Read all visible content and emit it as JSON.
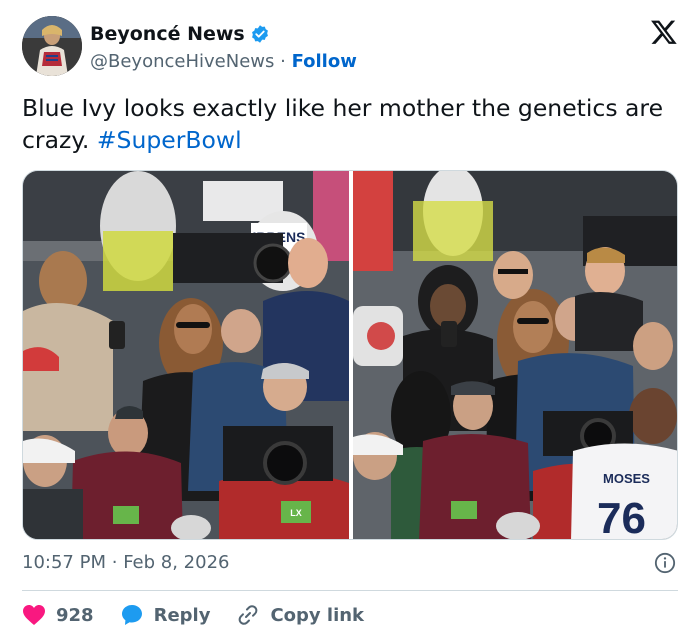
{
  "account": {
    "display_name": "Beyoncé News",
    "handle": "@BeyonceHiveNews",
    "separator": "·",
    "follow_label": "Follow",
    "verified": true
  },
  "tweet": {
    "text": "Blue Ivy looks exactly like her mother the genetics are crazy.",
    "hashtag": "#SuperBowl"
  },
  "media": {
    "photo_count": 2,
    "left_photo": {
      "jersey_text": "IBBENS",
      "credential_text": "LX"
    },
    "right_photo": {
      "jersey_name": "MOSES",
      "jersey_number": "76"
    }
  },
  "meta": {
    "time": "10:57 PM",
    "separator": "·",
    "date": "Feb 8, 2026"
  },
  "actions": {
    "like_count": "928",
    "reply_label": "Reply",
    "copy_link_label": "Copy link"
  },
  "colors": {
    "link": "#0066cc",
    "like": "#f91880",
    "secondary_text": "#536471",
    "verified_badge": "#1d9bf0",
    "border": "#cfd9de"
  }
}
